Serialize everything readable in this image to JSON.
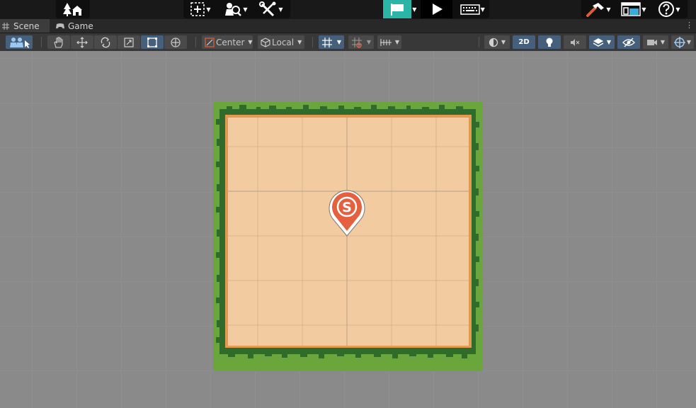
{
  "top_toolbar": {
    "account_icon": "home-tree-icon",
    "create_icon": "plus-box-icon",
    "search_icon": "search-icon",
    "tools_icon": "wrench-icon",
    "play_mode": {
      "play_icon": "play-icon",
      "flag_icon": "flag-icon",
      "keyboard_icon": "keyboard-icon"
    },
    "build_icon": "hammer-icon",
    "layout_icon": "layout-icon",
    "help_icon": "help-icon"
  },
  "tabs": [
    {
      "label": "Scene",
      "icon": "grid-icon"
    },
    {
      "label": "Game",
      "icon": "gamepad-icon"
    }
  ],
  "scene_toolbar": {
    "pivot_mode": "Center",
    "pivot_rotation": "Local",
    "view_2d": "2D"
  },
  "colors": {
    "accent": "#46607c",
    "flag_accent": "#2bb5a8",
    "grass": "#6aa63b",
    "dirt": "#f2cba0",
    "marker": "#e4603e"
  },
  "scene": {
    "marker_letter": "S"
  }
}
